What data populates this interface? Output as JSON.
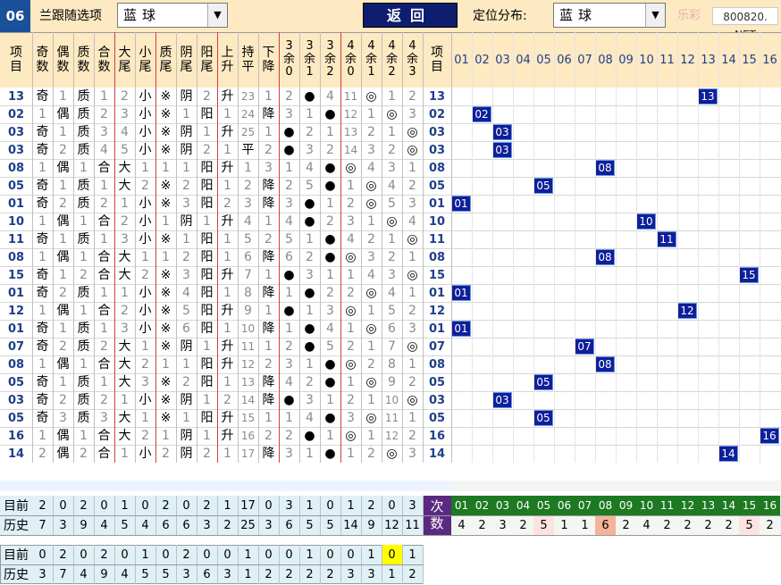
{
  "top": {
    "period": "06",
    "follow_label": "兰跟随选项",
    "follow_select": "蓝球",
    "back_label": "返回",
    "dist_label": "定位分布:",
    "dist_select": "蓝球",
    "watermark_left": "乐彩",
    "watermark_site": "800820. NET"
  },
  "colors": {
    "period_bg": "#1a4f9a",
    "square_fill": "#0f1f9a",
    "header_bg": "#fde9c2",
    "count_bg": "#5a2a82",
    "next_green": "#1e7a22",
    "row_blue": "#1f3f8a"
  },
  "headers": {
    "item_left": "项目",
    "item_right": "项目",
    "cols": [
      "奇数",
      "偶数",
      "质数",
      "合数",
      "大尾",
      "小尾",
      "质尾",
      "阴尾",
      "阳尾",
      "上升",
      "持平",
      "下降",
      "3余0",
      "3余1",
      "3余2",
      "4余0",
      "4余1",
      "4余2",
      "4余3"
    ],
    "numbers": [
      "01",
      "02",
      "03",
      "04",
      "05",
      "06",
      "07",
      "08",
      "09",
      "10",
      "11",
      "12",
      "13",
      "14",
      "15",
      "16"
    ]
  },
  "rows": [
    {
      "n": "13",
      "c": [
        "奇",
        "1",
        "质",
        "1",
        "2",
        "小",
        "※",
        "阴",
        "2",
        "升",
        "23",
        "1",
        "2",
        "●",
        "4",
        "11",
        "◎",
        "1",
        "2"
      ]
    },
    {
      "n": "02",
      "c": [
        "1",
        "偶",
        "质",
        "2",
        "3",
        "小",
        "※",
        "1",
        "阳",
        "1",
        "24",
        "降",
        "3",
        "1",
        "●",
        "12",
        "1",
        "◎",
        "3"
      ]
    },
    {
      "n": "03",
      "c": [
        "奇",
        "1",
        "质",
        "3",
        "4",
        "小",
        "※",
        "阴",
        "1",
        "升",
        "25",
        "1",
        "●",
        "2",
        "1",
        "13",
        "2",
        "1",
        "◎"
      ]
    },
    {
      "n": "03",
      "c": [
        "奇",
        "2",
        "质",
        "4",
        "5",
        "小",
        "※",
        "阴",
        "2",
        "1",
        "平",
        "2",
        "●",
        "3",
        "2",
        "14",
        "3",
        "2",
        "◎"
      ]
    },
    {
      "n": "08",
      "c": [
        "1",
        "偶",
        "1",
        "合",
        "大",
        "1",
        "1",
        "1",
        "阳",
        "升",
        "1",
        "3",
        "1",
        "4",
        "●",
        "◎",
        "4",
        "3",
        "1"
      ]
    },
    {
      "n": "05",
      "c": [
        "奇",
        "1",
        "质",
        "1",
        "大",
        "2",
        "※",
        "2",
        "阳",
        "1",
        "2",
        "降",
        "2",
        "5",
        "●",
        "1",
        "◎",
        "4",
        "2"
      ]
    },
    {
      "n": "01",
      "c": [
        "奇",
        "2",
        "质",
        "2",
        "1",
        "小",
        "※",
        "3",
        "阳",
        "2",
        "3",
        "降",
        "3",
        "●",
        "1",
        "2",
        "◎",
        "5",
        "3"
      ]
    },
    {
      "n": "10",
      "c": [
        "1",
        "偶",
        "1",
        "合",
        "2",
        "小",
        "1",
        "阴",
        "1",
        "升",
        "4",
        "1",
        "4",
        "●",
        "2",
        "3",
        "1",
        "◎",
        "4"
      ]
    },
    {
      "n": "11",
      "c": [
        "奇",
        "1",
        "质",
        "1",
        "3",
        "小",
        "※",
        "1",
        "阳",
        "1",
        "5",
        "2",
        "5",
        "1",
        "●",
        "4",
        "2",
        "1",
        "◎"
      ]
    },
    {
      "n": "08",
      "c": [
        "1",
        "偶",
        "1",
        "合",
        "大",
        "1",
        "1",
        "2",
        "阳",
        "1",
        "6",
        "降",
        "6",
        "2",
        "●",
        "◎",
        "3",
        "2",
        "1"
      ]
    },
    {
      "n": "15",
      "c": [
        "奇",
        "1",
        "2",
        "合",
        "大",
        "2",
        "※",
        "3",
        "阳",
        "升",
        "7",
        "1",
        "●",
        "3",
        "1",
        "1",
        "4",
        "3",
        "◎"
      ]
    },
    {
      "n": "01",
      "c": [
        "奇",
        "2",
        "质",
        "1",
        "1",
        "小",
        "※",
        "4",
        "阳",
        "1",
        "8",
        "降",
        "1",
        "●",
        "2",
        "2",
        "◎",
        "4",
        "1"
      ]
    },
    {
      "n": "12",
      "c": [
        "1",
        "偶",
        "1",
        "合",
        "2",
        "小",
        "※",
        "5",
        "阳",
        "升",
        "9",
        "1",
        "●",
        "1",
        "3",
        "◎",
        "1",
        "5",
        "2"
      ]
    },
    {
      "n": "01",
      "c": [
        "奇",
        "1",
        "质",
        "1",
        "3",
        "小",
        "※",
        "6",
        "阳",
        "1",
        "10",
        "降",
        "1",
        "●",
        "4",
        "1",
        "◎",
        "6",
        "3"
      ]
    },
    {
      "n": "07",
      "c": [
        "奇",
        "2",
        "质",
        "2",
        "大",
        "1",
        "※",
        "阴",
        "1",
        "升",
        "11",
        "1",
        "2",
        "●",
        "5",
        "2",
        "1",
        "7",
        "◎"
      ]
    },
    {
      "n": "08",
      "c": [
        "1",
        "偶",
        "1",
        "合",
        "大",
        "2",
        "1",
        "1",
        "阳",
        "升",
        "12",
        "2",
        "3",
        "1",
        "●",
        "◎",
        "2",
        "8",
        "1"
      ]
    },
    {
      "n": "05",
      "c": [
        "奇",
        "1",
        "质",
        "1",
        "大",
        "3",
        "※",
        "2",
        "阳",
        "1",
        "13",
        "降",
        "4",
        "2",
        "●",
        "1",
        "◎",
        "9",
        "2"
      ]
    },
    {
      "n": "03",
      "c": [
        "奇",
        "2",
        "质",
        "2",
        "1",
        "小",
        "※",
        "阴",
        "1",
        "2",
        "14",
        "降",
        "●",
        "3",
        "1",
        "2",
        "1",
        "10",
        "◎"
      ]
    },
    {
      "n": "05",
      "c": [
        "奇",
        "3",
        "质",
        "3",
        "大",
        "1",
        "※",
        "1",
        "阳",
        "升",
        "15",
        "1",
        "1",
        "4",
        "●",
        "3",
        "◎",
        "11",
        "1"
      ]
    },
    {
      "n": "16",
      "c": [
        "1",
        "偶",
        "1",
        "合",
        "大",
        "2",
        "1",
        "阴",
        "1",
        "升",
        "16",
        "2",
        "2",
        "●",
        "1",
        "◎",
        "1",
        "12",
        "2"
      ]
    },
    {
      "n": "14",
      "c": [
        "2",
        "偶",
        "2",
        "合",
        "1",
        "小",
        "2",
        "阴",
        "2",
        "1",
        "17",
        "降",
        "3",
        "1",
        "●",
        "1",
        "2",
        "◎",
        "3"
      ]
    }
  ],
  "bottom": {
    "current_label": "目前",
    "history_label": "历史",
    "current": [
      "2",
      "0",
      "2",
      "0",
      "1",
      "0",
      "2",
      "0",
      "2",
      "1",
      "17",
      "0",
      "3",
      "1",
      "0",
      "1",
      "2",
      "0",
      "3"
    ],
    "history": [
      "7",
      "3",
      "9",
      "4",
      "5",
      "4",
      "6",
      "6",
      "3",
      "2",
      "25",
      "3",
      "6",
      "5",
      "5",
      "14",
      "9",
      "12",
      "11"
    ],
    "count_label": "次数",
    "num_counts": [
      "4",
      "2",
      "3",
      "2",
      "5",
      "1",
      "1",
      "6",
      "2",
      "4",
      "2",
      "2",
      "2",
      "2",
      "5",
      "2"
    ],
    "current2": [
      "0",
      "2",
      "0",
      "2",
      "0",
      "1",
      "0",
      "2",
      "0",
      "0",
      "1",
      "0",
      "0",
      "1",
      "0",
      "0",
      "1",
      "0",
      "1",
      "0"
    ],
    "history2": [
      "3",
      "7",
      "4",
      "9",
      "4",
      "5",
      "5",
      "3",
      "6",
      "3",
      "1",
      "2",
      "2",
      "2",
      "2",
      "3",
      "3",
      "1",
      "2"
    ]
  }
}
